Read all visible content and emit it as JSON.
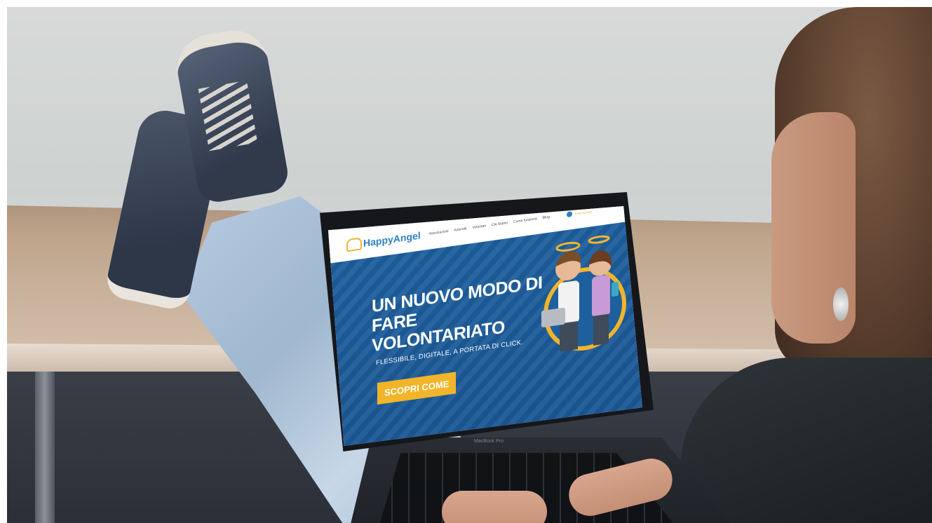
{
  "nav": {
    "logo_text": "HappyAngel",
    "items": [
      "Associazioni",
      "Aziende",
      "Volontari",
      "Chi Siamo",
      "Come funziona",
      "Blog"
    ],
    "cta": "Il mio account"
  },
  "hero": {
    "title_line1": "UN NUOVO MODO DI",
    "title_line2": "FARE VOLONTARIATO",
    "subtitle": "FLESSIBILE, DIGITALE, A PORTATA DI CLICK.",
    "button": "SCOPRI COME"
  },
  "laptop": {
    "model": "MacBook Pro"
  },
  "colors": {
    "brand_blue": "#2c7fc4",
    "hero_blue": "#1d5c9a",
    "accent_yellow": "#f2b52a"
  },
  "icons": [
    "user-icon",
    "angel-logo-icon"
  ]
}
